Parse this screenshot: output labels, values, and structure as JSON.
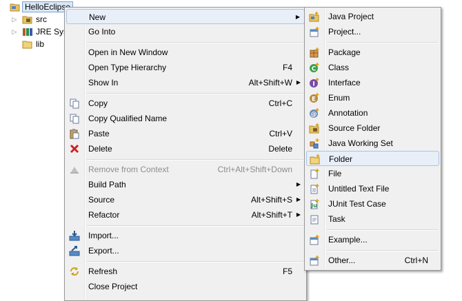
{
  "tree": {
    "project": "HelloEclipse",
    "items": [
      "src",
      "JRE Syst",
      "lib"
    ]
  },
  "context_menu": {
    "new": "New",
    "go_into": "Go Into",
    "open_new_window": "Open in New Window",
    "open_type_hierarchy": "Open Type Hierarchy",
    "open_type_hierarchy_sc": "F4",
    "show_in": "Show In",
    "show_in_sc": "Alt+Shift+W",
    "copy": "Copy",
    "copy_sc": "Ctrl+C",
    "copy_qualified": "Copy Qualified Name",
    "paste": "Paste",
    "paste_sc": "Ctrl+V",
    "delete": "Delete",
    "delete_sc": "Delete",
    "remove_context": "Remove from Context",
    "remove_context_sc": "Ctrl+Alt+Shift+Down",
    "build_path": "Build Path",
    "source": "Source",
    "source_sc": "Alt+Shift+S",
    "refactor": "Refactor",
    "refactor_sc": "Alt+Shift+T",
    "import": "Import...",
    "export": "Export...",
    "refresh": "Refresh",
    "refresh_sc": "F5",
    "close_project": "Close Project"
  },
  "new_submenu": {
    "java_project": "Java Project",
    "project": "Project...",
    "package": "Package",
    "class": "Class",
    "interface": "Interface",
    "enum": "Enum",
    "annotation": "Annotation",
    "source_folder": "Source Folder",
    "java_working_set": "Java Working Set",
    "folder": "Folder",
    "file": "File",
    "untitled_text_file": "Untitled Text File",
    "junit_test_case": "JUnit Test Case",
    "task": "Task",
    "example": "Example...",
    "other": "Other...",
    "other_sc": "Ctrl+N"
  },
  "colors": {
    "menu_bg": "#f0f0f0",
    "highlight": "#e8eff8",
    "highlight_border": "#a8c4e6",
    "disabled_text": "#8d8d8d"
  }
}
